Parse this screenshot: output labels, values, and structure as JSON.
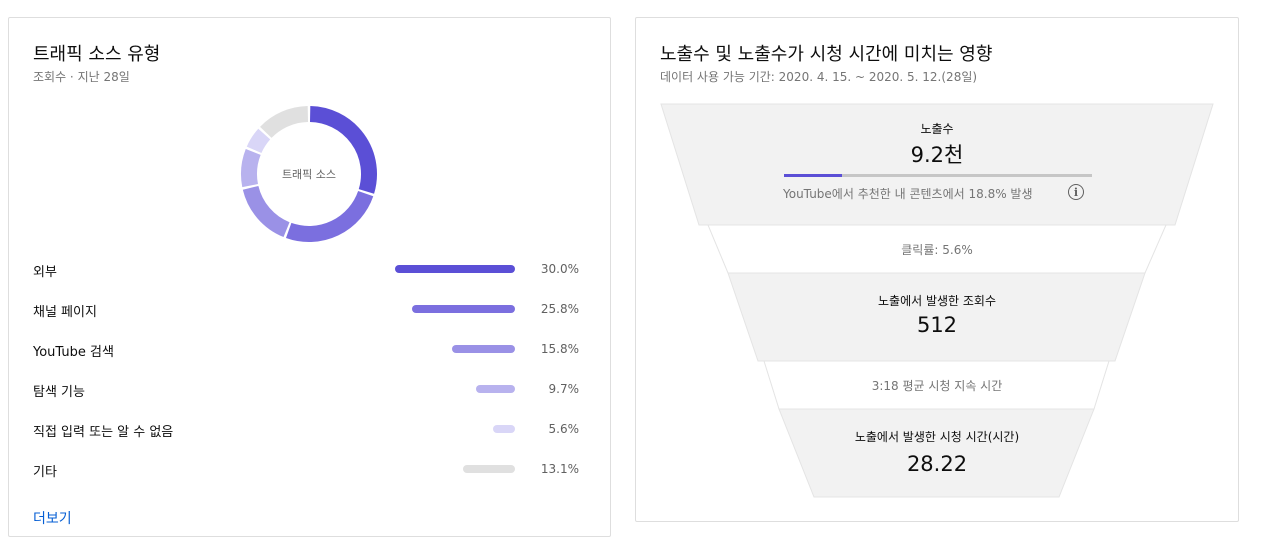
{
  "traffic": {
    "title": "트래픽 소스 유형",
    "subtitle": "조회수 · 지난 28일",
    "donut_center": "트래픽 소스",
    "more_link": "더보기",
    "sources": [
      {
        "label": "외부",
        "percent": 30.0,
        "percent_text": "30.0%",
        "color": "#5b4fd6"
      },
      {
        "label": "채널 페이지",
        "percent": 25.8,
        "percent_text": "25.8%",
        "color": "#7b6fdf"
      },
      {
        "label": "YouTube 검색",
        "percent": 15.8,
        "percent_text": "15.8%",
        "color": "#9a91e6"
      },
      {
        "label": "탐색 기능",
        "percent": 9.7,
        "percent_text": "9.7%",
        "color": "#b8b2ee"
      },
      {
        "label": "직접 입력 또는 알 수 없음",
        "percent": 5.6,
        "percent_text": "5.6%",
        "color": "#d9d6f7"
      },
      {
        "label": "기타",
        "percent": 13.1,
        "percent_text": "13.1%",
        "color": "#e0e0e0"
      }
    ]
  },
  "funnel": {
    "title": "노출수 및 노출수가 시청 시간에 미치는 영향",
    "subtitle": "데이터 사용 가능 기간: 2020. 4. 15. ~ 2020. 5. 12.(28일)",
    "impressions_label": "노출수",
    "impressions_value": "9.2천",
    "recommended_fraction": 0.188,
    "recommended_text": "YouTube에서 추천한 내 콘텐츠에서 18.8% 발생",
    "ctr_text": "클릭률: 5.6%",
    "views_label": "노출에서 발생한 조회수",
    "views_value": "512",
    "avg_view_text": "3:18 평균 시청 지속 시간",
    "watch_label": "노출에서 발생한 시청 시간(시간)",
    "watch_value": "28.22",
    "accent_color": "#5b4fd6"
  }
}
